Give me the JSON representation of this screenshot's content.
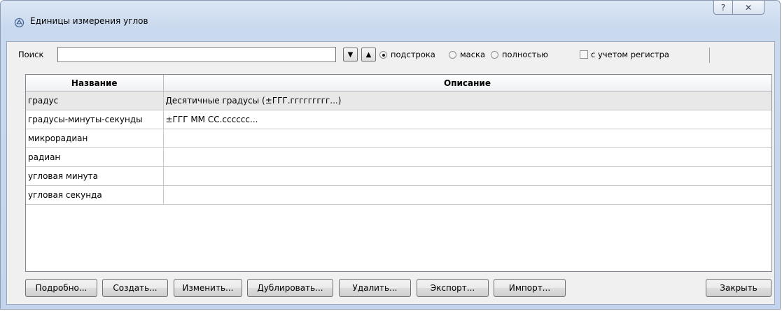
{
  "window": {
    "title": "Единицы измерения углов",
    "help_glyph": "?",
    "close_glyph": "✕"
  },
  "search": {
    "label": "Поиск",
    "value": "",
    "down_glyph": "▼",
    "up_glyph": "▲",
    "options": [
      "подстрока",
      "маска",
      "полностью"
    ],
    "selected_option": "подстрока",
    "case_label": "с учетом регистра",
    "case_checked": false
  },
  "table": {
    "columns": [
      "Название",
      "Описание"
    ],
    "rows": [
      {
        "name": "градус",
        "desc": "Десятичные градусы (±ГГГ.ггггггггг...)"
      },
      {
        "name": "градусы-минуты-секунды",
        "desc": "±ГГГ ММ СС.сссссс..."
      },
      {
        "name": "микрорадиан",
        "desc": ""
      },
      {
        "name": "радиан",
        "desc": ""
      },
      {
        "name": "угловая минута",
        "desc": ""
      },
      {
        "name": "угловая секунда",
        "desc": ""
      }
    ],
    "selected_row": 0
  },
  "buttons": {
    "details": "Подробно...",
    "create": "Создать...",
    "edit": "Изменить...",
    "duplicate": "Дублировать...",
    "delete": "Удалить...",
    "export": "Экспорт...",
    "import": "Импорт...",
    "close": "Закрыть"
  },
  "icons": {
    "title_icon": "angle-unit-icon",
    "help": "help-icon",
    "close": "close-icon"
  }
}
